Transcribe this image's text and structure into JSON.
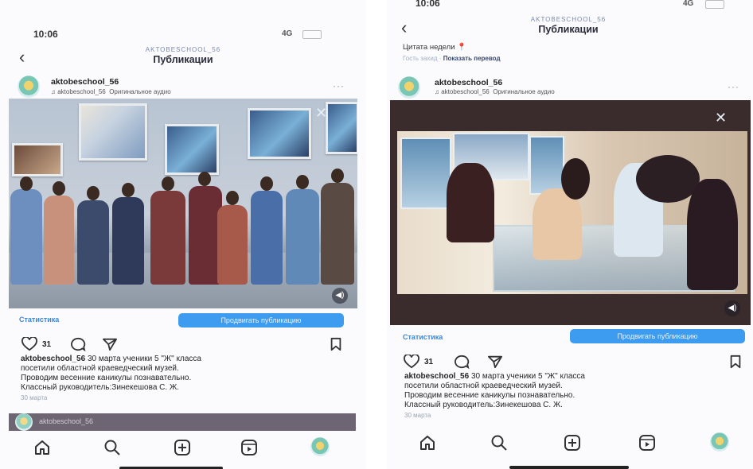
{
  "left": {
    "status": {
      "time": "10:06",
      "signal": "4G"
    },
    "header": {
      "account": "AKTOBESCHOOL_56",
      "title": "Публикации"
    },
    "post": {
      "username": "aktobeschool_56",
      "audio_user": "aktobeschool_56",
      "audio_label": "Оригинальное аудио",
      "stats_label": "Статистика",
      "promote_label": "Продвигать публикацию",
      "likes": "31",
      "caption_user": "aktobeschool_56",
      "caption_lines": [
        "30 марта ученики 5 \"Ж\" класса",
        "посетили областной краеведческий музей.",
        "Проводим весенние каникулы познавательно.",
        "Классный руководитель:Зинекешова С. Ж."
      ],
      "date": "30 марта"
    },
    "next_post_user": "aktobeschool_56"
  },
  "right": {
    "status": {
      "time": "10:06",
      "signal": "4G"
    },
    "header": {
      "account": "AKTOBESCHOOL_56",
      "title": "Публикации"
    },
    "quote": "Цитата недели",
    "translation": {
      "prefix": "Гость захид",
      "link": "Показать перевод"
    },
    "post": {
      "username": "aktobeschool_56",
      "audio_user": "aktobeschool_56",
      "audio_label": "Оригинальное аудио",
      "stats_label": "Статистика",
      "promote_label": "Продвигать публикацию",
      "likes": "31",
      "caption_user": "aktobeschool_56",
      "caption_lines": [
        "30 марта ученики 5 \"Ж\" класса",
        "посетили областной краеведческий музей.",
        "Проводим весенние каникулы познавательно.",
        "Классный руководитель:Зинекешова С. Ж."
      ],
      "date": "30 марта"
    }
  },
  "icons": {
    "back": "chevron-left-icon",
    "like": "heart-icon",
    "comment": "comment-icon",
    "share": "send-icon",
    "save": "bookmark-icon",
    "home": "home-icon",
    "search": "search-icon",
    "create": "plus-square-icon",
    "reels": "reels-icon",
    "profile": "profile-avatar-icon"
  },
  "colors": {
    "accent": "#3d9cf0",
    "link": "#3a86d8",
    "pin": "#e0414f"
  }
}
